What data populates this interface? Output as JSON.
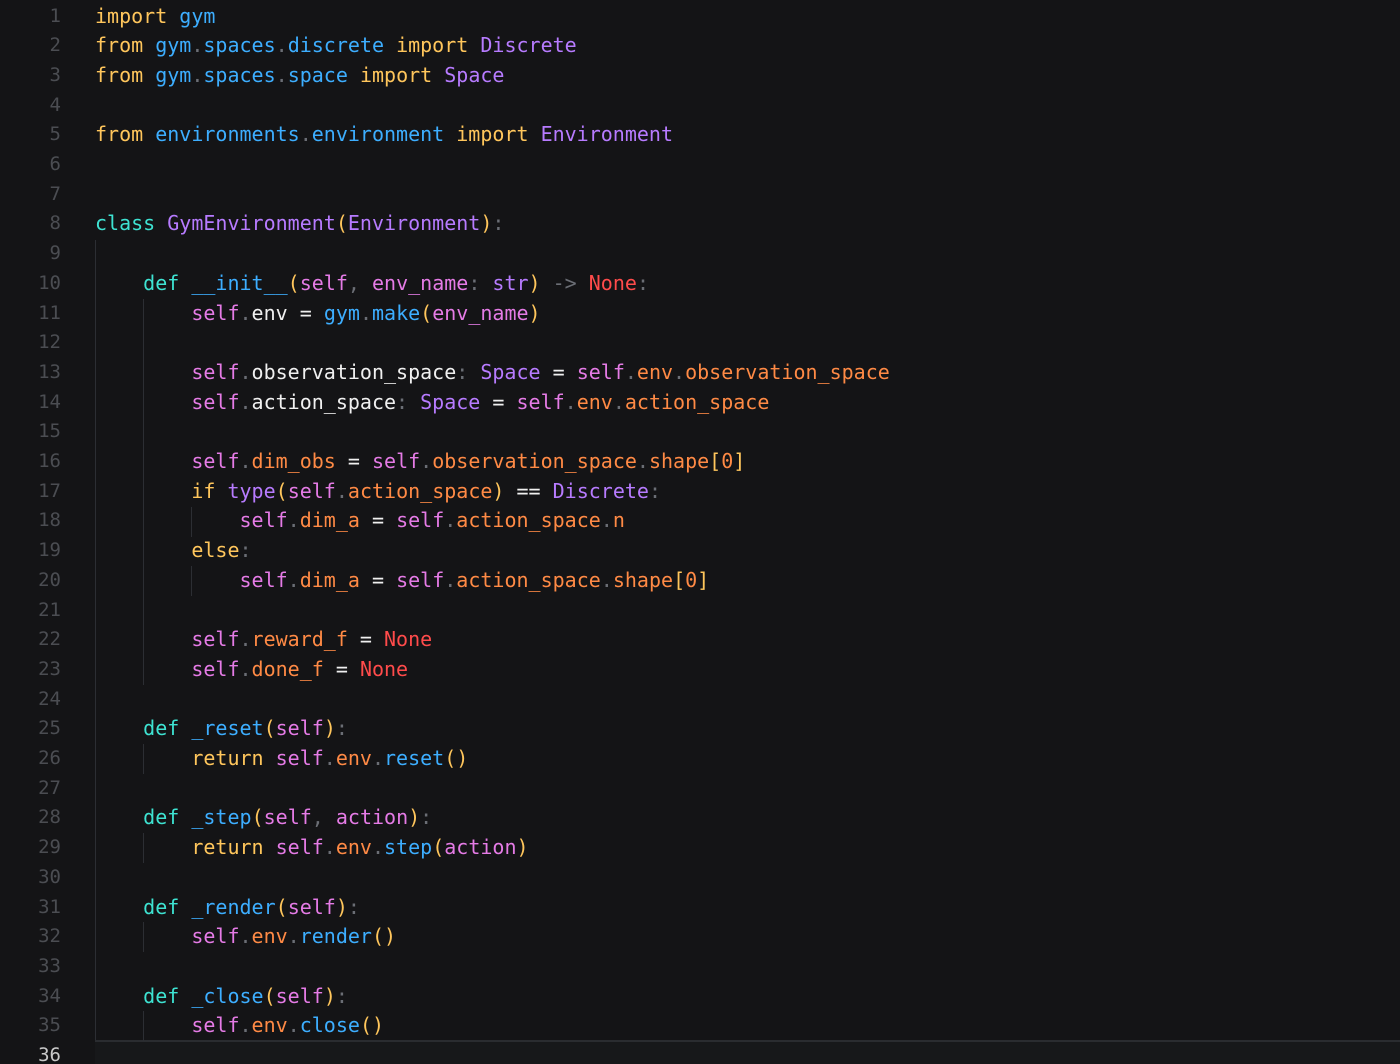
{
  "editor": {
    "active_line": 36,
    "lines": [
      {
        "n": "1",
        "tokens": [
          [
            "kw",
            "import"
          ],
          [
            "plain",
            " "
          ],
          [
            "mod",
            "gym"
          ]
        ]
      },
      {
        "n": "2",
        "tokens": [
          [
            "kw",
            "from"
          ],
          [
            "plain",
            " "
          ],
          [
            "mod",
            "gym"
          ],
          [
            "pun",
            "."
          ],
          [
            "mod",
            "spaces"
          ],
          [
            "pun",
            "."
          ],
          [
            "mod",
            "discrete"
          ],
          [
            "plain",
            " "
          ],
          [
            "kw",
            "import"
          ],
          [
            "plain",
            " "
          ],
          [
            "cls",
            "Discrete"
          ]
        ]
      },
      {
        "n": "3",
        "tokens": [
          [
            "kw",
            "from"
          ],
          [
            "plain",
            " "
          ],
          [
            "mod",
            "gym"
          ],
          [
            "pun",
            "."
          ],
          [
            "mod",
            "spaces"
          ],
          [
            "pun",
            "."
          ],
          [
            "mod",
            "space"
          ],
          [
            "plain",
            " "
          ],
          [
            "kw",
            "import"
          ],
          [
            "plain",
            " "
          ],
          [
            "cls",
            "Space"
          ]
        ]
      },
      {
        "n": "4",
        "tokens": []
      },
      {
        "n": "5",
        "tokens": [
          [
            "kw",
            "from"
          ],
          [
            "plain",
            " "
          ],
          [
            "mod",
            "environments"
          ],
          [
            "pun",
            "."
          ],
          [
            "mod",
            "environment"
          ],
          [
            "plain",
            " "
          ],
          [
            "kw",
            "import"
          ],
          [
            "plain",
            " "
          ],
          [
            "cls",
            "Environment"
          ]
        ]
      },
      {
        "n": "6",
        "tokens": []
      },
      {
        "n": "7",
        "tokens": []
      },
      {
        "n": "8",
        "tokens": [
          [
            "kwd",
            "class"
          ],
          [
            "plain",
            " "
          ],
          [
            "cls",
            "GymEnvironment"
          ],
          [
            "par",
            "("
          ],
          [
            "cls",
            "Environment"
          ],
          [
            "par",
            ")"
          ],
          [
            "pun",
            ":"
          ]
        ]
      },
      {
        "n": "9",
        "tokens": []
      },
      {
        "n": "10",
        "tokens": [
          [
            "plain",
            "    "
          ],
          [
            "kwd",
            "def"
          ],
          [
            "plain",
            " "
          ],
          [
            "fn",
            "__init__"
          ],
          [
            "par",
            "("
          ],
          [
            "slf",
            "self"
          ],
          [
            "pun",
            ","
          ],
          [
            "plain",
            " "
          ],
          [
            "prm",
            "env_name"
          ],
          [
            "pun",
            ":"
          ],
          [
            "plain",
            " "
          ],
          [
            "cls",
            "str"
          ],
          [
            "par",
            ")"
          ],
          [
            "plain",
            " "
          ],
          [
            "pun",
            "->"
          ],
          [
            "plain",
            " "
          ],
          [
            "const",
            "None"
          ],
          [
            "pun",
            ":"
          ]
        ]
      },
      {
        "n": "11",
        "tokens": [
          [
            "plain",
            "        "
          ],
          [
            "slf",
            "self"
          ],
          [
            "pun",
            "."
          ],
          [
            "plain",
            "env"
          ],
          [
            "plain",
            " "
          ],
          [
            "op",
            "="
          ],
          [
            "plain",
            " "
          ],
          [
            "mod",
            "gym"
          ],
          [
            "pun",
            "."
          ],
          [
            "fn",
            "make"
          ],
          [
            "par",
            "("
          ],
          [
            "prm",
            "env_name"
          ],
          [
            "par",
            ")"
          ]
        ]
      },
      {
        "n": "12",
        "tokens": []
      },
      {
        "n": "13",
        "tokens": [
          [
            "plain",
            "        "
          ],
          [
            "slf",
            "self"
          ],
          [
            "pun",
            "."
          ],
          [
            "plain",
            "observation_space"
          ],
          [
            "pun",
            ":"
          ],
          [
            "plain",
            " "
          ],
          [
            "cls",
            "Space"
          ],
          [
            "plain",
            " "
          ],
          [
            "op",
            "="
          ],
          [
            "plain",
            " "
          ],
          [
            "slf",
            "self"
          ],
          [
            "pun",
            "."
          ],
          [
            "attr",
            "env"
          ],
          [
            "pun",
            "."
          ],
          [
            "attr",
            "observation_space"
          ]
        ]
      },
      {
        "n": "14",
        "tokens": [
          [
            "plain",
            "        "
          ],
          [
            "slf",
            "self"
          ],
          [
            "pun",
            "."
          ],
          [
            "plain",
            "action_space"
          ],
          [
            "pun",
            ":"
          ],
          [
            "plain",
            " "
          ],
          [
            "cls",
            "Space"
          ],
          [
            "plain",
            " "
          ],
          [
            "op",
            "="
          ],
          [
            "plain",
            " "
          ],
          [
            "slf",
            "self"
          ],
          [
            "pun",
            "."
          ],
          [
            "attr",
            "env"
          ],
          [
            "pun",
            "."
          ],
          [
            "attr",
            "action_space"
          ]
        ]
      },
      {
        "n": "15",
        "tokens": []
      },
      {
        "n": "16",
        "tokens": [
          [
            "plain",
            "        "
          ],
          [
            "slf",
            "self"
          ],
          [
            "pun",
            "."
          ],
          [
            "attr",
            "dim_obs"
          ],
          [
            "plain",
            " "
          ],
          [
            "op",
            "="
          ],
          [
            "plain",
            " "
          ],
          [
            "slf",
            "self"
          ],
          [
            "pun",
            "."
          ],
          [
            "attr",
            "observation_space"
          ],
          [
            "pun",
            "."
          ],
          [
            "attr",
            "shape"
          ],
          [
            "par",
            "["
          ],
          [
            "num",
            "0"
          ],
          [
            "par",
            "]"
          ]
        ]
      },
      {
        "n": "17",
        "tokens": [
          [
            "plain",
            "        "
          ],
          [
            "kw",
            "if"
          ],
          [
            "plain",
            " "
          ],
          [
            "cls",
            "type"
          ],
          [
            "par",
            "("
          ],
          [
            "slf",
            "self"
          ],
          [
            "pun",
            "."
          ],
          [
            "attr",
            "action_space"
          ],
          [
            "par",
            ")"
          ],
          [
            "plain",
            " "
          ],
          [
            "op",
            "=="
          ],
          [
            "plain",
            " "
          ],
          [
            "cls",
            "Discrete"
          ],
          [
            "pun",
            ":"
          ]
        ]
      },
      {
        "n": "18",
        "tokens": [
          [
            "plain",
            "            "
          ],
          [
            "slf",
            "self"
          ],
          [
            "pun",
            "."
          ],
          [
            "attr",
            "dim_a"
          ],
          [
            "plain",
            " "
          ],
          [
            "op",
            "="
          ],
          [
            "plain",
            " "
          ],
          [
            "slf",
            "self"
          ],
          [
            "pun",
            "."
          ],
          [
            "attr",
            "action_space"
          ],
          [
            "pun",
            "."
          ],
          [
            "attr",
            "n"
          ]
        ]
      },
      {
        "n": "19",
        "tokens": [
          [
            "plain",
            "        "
          ],
          [
            "kw",
            "else"
          ],
          [
            "pun",
            ":"
          ]
        ]
      },
      {
        "n": "20",
        "tokens": [
          [
            "plain",
            "            "
          ],
          [
            "slf",
            "self"
          ],
          [
            "pun",
            "."
          ],
          [
            "attr",
            "dim_a"
          ],
          [
            "plain",
            " "
          ],
          [
            "op",
            "="
          ],
          [
            "plain",
            " "
          ],
          [
            "slf",
            "self"
          ],
          [
            "pun",
            "."
          ],
          [
            "attr",
            "action_space"
          ],
          [
            "pun",
            "."
          ],
          [
            "attr",
            "shape"
          ],
          [
            "par",
            "["
          ],
          [
            "num",
            "0"
          ],
          [
            "par",
            "]"
          ]
        ]
      },
      {
        "n": "21",
        "tokens": []
      },
      {
        "n": "22",
        "tokens": [
          [
            "plain",
            "        "
          ],
          [
            "slf",
            "self"
          ],
          [
            "pun",
            "."
          ],
          [
            "attr",
            "reward_f"
          ],
          [
            "plain",
            " "
          ],
          [
            "op",
            "="
          ],
          [
            "plain",
            " "
          ],
          [
            "const",
            "None"
          ]
        ]
      },
      {
        "n": "23",
        "tokens": [
          [
            "plain",
            "        "
          ],
          [
            "slf",
            "self"
          ],
          [
            "pun",
            "."
          ],
          [
            "attr",
            "done_f"
          ],
          [
            "plain",
            " "
          ],
          [
            "op",
            "="
          ],
          [
            "plain",
            " "
          ],
          [
            "const",
            "None"
          ]
        ]
      },
      {
        "n": "24",
        "tokens": []
      },
      {
        "n": "25",
        "tokens": [
          [
            "plain",
            "    "
          ],
          [
            "kwd",
            "def"
          ],
          [
            "plain",
            " "
          ],
          [
            "fn",
            "_reset"
          ],
          [
            "par",
            "("
          ],
          [
            "slf",
            "self"
          ],
          [
            "par",
            ")"
          ],
          [
            "pun",
            ":"
          ]
        ]
      },
      {
        "n": "26",
        "tokens": [
          [
            "plain",
            "        "
          ],
          [
            "kw",
            "return"
          ],
          [
            "plain",
            " "
          ],
          [
            "slf",
            "self"
          ],
          [
            "pun",
            "."
          ],
          [
            "attr",
            "env"
          ],
          [
            "pun",
            "."
          ],
          [
            "fn",
            "reset"
          ],
          [
            "par",
            "()"
          ]
        ]
      },
      {
        "n": "27",
        "tokens": []
      },
      {
        "n": "28",
        "tokens": [
          [
            "plain",
            "    "
          ],
          [
            "kwd",
            "def"
          ],
          [
            "plain",
            " "
          ],
          [
            "fn",
            "_step"
          ],
          [
            "par",
            "("
          ],
          [
            "slf",
            "self"
          ],
          [
            "pun",
            ","
          ],
          [
            "plain",
            " "
          ],
          [
            "prm",
            "action"
          ],
          [
            "par",
            ")"
          ],
          [
            "pun",
            ":"
          ]
        ]
      },
      {
        "n": "29",
        "tokens": [
          [
            "plain",
            "        "
          ],
          [
            "kw",
            "return"
          ],
          [
            "plain",
            " "
          ],
          [
            "slf",
            "self"
          ],
          [
            "pun",
            "."
          ],
          [
            "attr",
            "env"
          ],
          [
            "pun",
            "."
          ],
          [
            "fn",
            "step"
          ],
          [
            "par",
            "("
          ],
          [
            "prm",
            "action"
          ],
          [
            "par",
            ")"
          ]
        ]
      },
      {
        "n": "30",
        "tokens": []
      },
      {
        "n": "31",
        "tokens": [
          [
            "plain",
            "    "
          ],
          [
            "kwd",
            "def"
          ],
          [
            "plain",
            " "
          ],
          [
            "fn",
            "_render"
          ],
          [
            "par",
            "("
          ],
          [
            "slf",
            "self"
          ],
          [
            "par",
            ")"
          ],
          [
            "pun",
            ":"
          ]
        ]
      },
      {
        "n": "32",
        "tokens": [
          [
            "plain",
            "        "
          ],
          [
            "slf",
            "self"
          ],
          [
            "pun",
            "."
          ],
          [
            "attr",
            "env"
          ],
          [
            "pun",
            "."
          ],
          [
            "fn",
            "render"
          ],
          [
            "par",
            "()"
          ]
        ]
      },
      {
        "n": "33",
        "tokens": []
      },
      {
        "n": "34",
        "tokens": [
          [
            "plain",
            "    "
          ],
          [
            "kwd",
            "def"
          ],
          [
            "plain",
            " "
          ],
          [
            "fn",
            "_close"
          ],
          [
            "par",
            "("
          ],
          [
            "slf",
            "self"
          ],
          [
            "par",
            ")"
          ],
          [
            "pun",
            ":"
          ]
        ]
      },
      {
        "n": "35",
        "tokens": [
          [
            "plain",
            "        "
          ],
          [
            "slf",
            "self"
          ],
          [
            "pun",
            "."
          ],
          [
            "attr",
            "env"
          ],
          [
            "pun",
            "."
          ],
          [
            "fn",
            "close"
          ],
          [
            "par",
            "()"
          ]
        ]
      },
      {
        "n": "36",
        "tokens": []
      }
    ]
  }
}
